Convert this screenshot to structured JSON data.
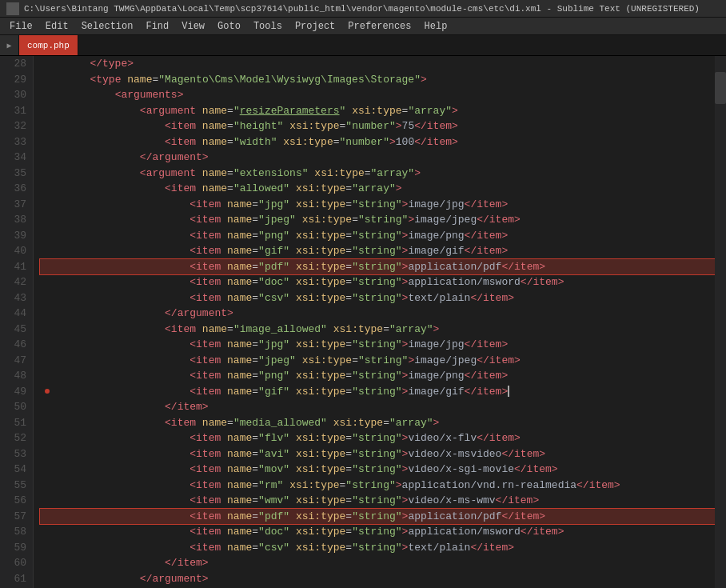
{
  "titlebar": {
    "icon": "sublime-icon",
    "title": "C:\\Users\\Bintang TWMG\\AppData\\Local\\Temp\\scp37614\\public_html\\vendor\\magento\\module-cms\\etc\\di.xml - Sublime Text (UNREGISTERED)"
  },
  "menubar": {
    "items": [
      "File",
      "Edit",
      "Selection",
      "Find",
      "View",
      "Goto",
      "Tools",
      "Project",
      "Preferences",
      "Help"
    ]
  },
  "tabs": [
    {
      "label": "comp.php",
      "active": false,
      "color": "red"
    }
  ],
  "lines": [
    {
      "num": 28,
      "indent": 2,
      "content": "closing_type"
    },
    {
      "num": 29,
      "indent": 2,
      "content": "type_magento"
    },
    {
      "num": 30,
      "indent": 3,
      "content": "arguments_open"
    },
    {
      "num": 31,
      "indent": 4,
      "content": "argument_resizeParameters"
    },
    {
      "num": 32,
      "indent": 5,
      "content": "item_height"
    },
    {
      "num": 33,
      "indent": 5,
      "content": "item_width"
    },
    {
      "num": 34,
      "indent": 4,
      "content": "argument_close"
    },
    {
      "num": 35,
      "indent": 3,
      "content": "argument_extensions"
    },
    {
      "num": 36,
      "indent": 4,
      "content": "item_allowed_array"
    },
    {
      "num": 37,
      "indent": 5,
      "content": "item_jpg"
    },
    {
      "num": 38,
      "indent": 5,
      "content": "item_jpeg"
    },
    {
      "num": 39,
      "indent": 5,
      "content": "item_png"
    },
    {
      "num": 40,
      "indent": 5,
      "content": "item_gif"
    },
    {
      "num": 41,
      "indent": 5,
      "content": "item_pdf_highlighted"
    },
    {
      "num": 42,
      "indent": 5,
      "content": "item_doc"
    },
    {
      "num": 43,
      "indent": 5,
      "content": "item_csv"
    },
    {
      "num": 44,
      "indent": 4,
      "content": "argument_close2"
    },
    {
      "num": 45,
      "indent": 4,
      "content": "item_image_allowed"
    },
    {
      "num": 46,
      "indent": 5,
      "content": "item_jpg2"
    },
    {
      "num": 47,
      "indent": 5,
      "content": "item_jpeg2"
    },
    {
      "num": 48,
      "indent": 5,
      "content": "item_png2"
    },
    {
      "num": 49,
      "indent": 5,
      "content": "item_gif2"
    },
    {
      "num": 50,
      "indent": 4,
      "content": "item_close"
    },
    {
      "num": 51,
      "indent": 4,
      "content": "item_media_allowed"
    },
    {
      "num": 52,
      "indent": 5,
      "content": "item_flv"
    },
    {
      "num": 53,
      "indent": 5,
      "content": "item_avi"
    },
    {
      "num": 54,
      "indent": 5,
      "content": "item_mov"
    },
    {
      "num": 55,
      "indent": 5,
      "content": "item_rm"
    },
    {
      "num": 56,
      "indent": 5,
      "content": "item_wmv"
    },
    {
      "num": 57,
      "indent": 5,
      "content": "item_pdf2_highlighted"
    },
    {
      "num": 58,
      "indent": 5,
      "content": "item_doc2"
    },
    {
      "num": 59,
      "indent": 5,
      "content": "item_csv2"
    },
    {
      "num": 60,
      "indent": 4,
      "content": "item_close2"
    },
    {
      "num": 61,
      "indent": 3,
      "content": "argument_close3"
    }
  ]
}
